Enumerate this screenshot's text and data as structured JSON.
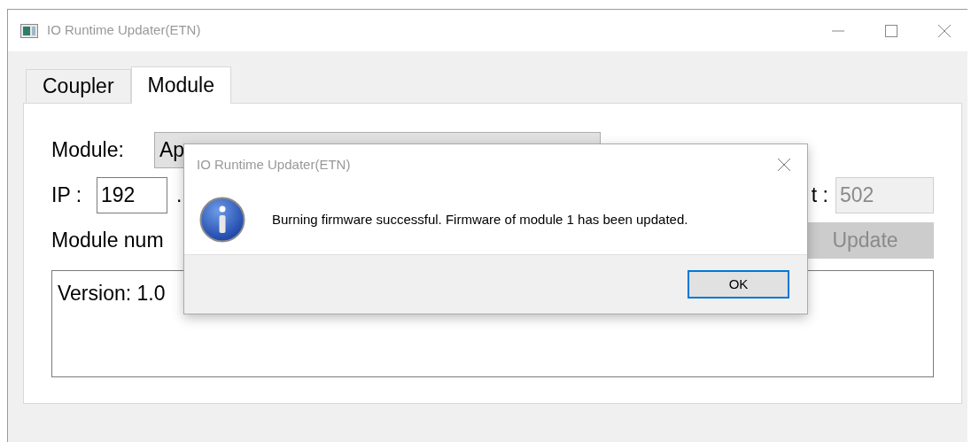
{
  "window": {
    "title": "IO Runtime Updater(ETN)"
  },
  "tabs": [
    {
      "label": "Coupler",
      "selected": false
    },
    {
      "label": "Module",
      "selected": true
    }
  ],
  "module_row": {
    "label": "Module:",
    "value": "Ap"
  },
  "ip_row": {
    "label": "IP :",
    "octet": "192",
    "separator": ".",
    "port_label": "t :",
    "port_value": "502",
    "port_disabled": true
  },
  "module_number_row": {
    "label": "Module num",
    "button": {
      "label": "Update",
      "disabled": true
    }
  },
  "log": {
    "text": "Version: 1.0"
  },
  "dialog": {
    "title": "IO Runtime Updater(ETN)",
    "message": "Burning firmware successful. Firmware of module 1 has been updated.",
    "button": "OK"
  }
}
